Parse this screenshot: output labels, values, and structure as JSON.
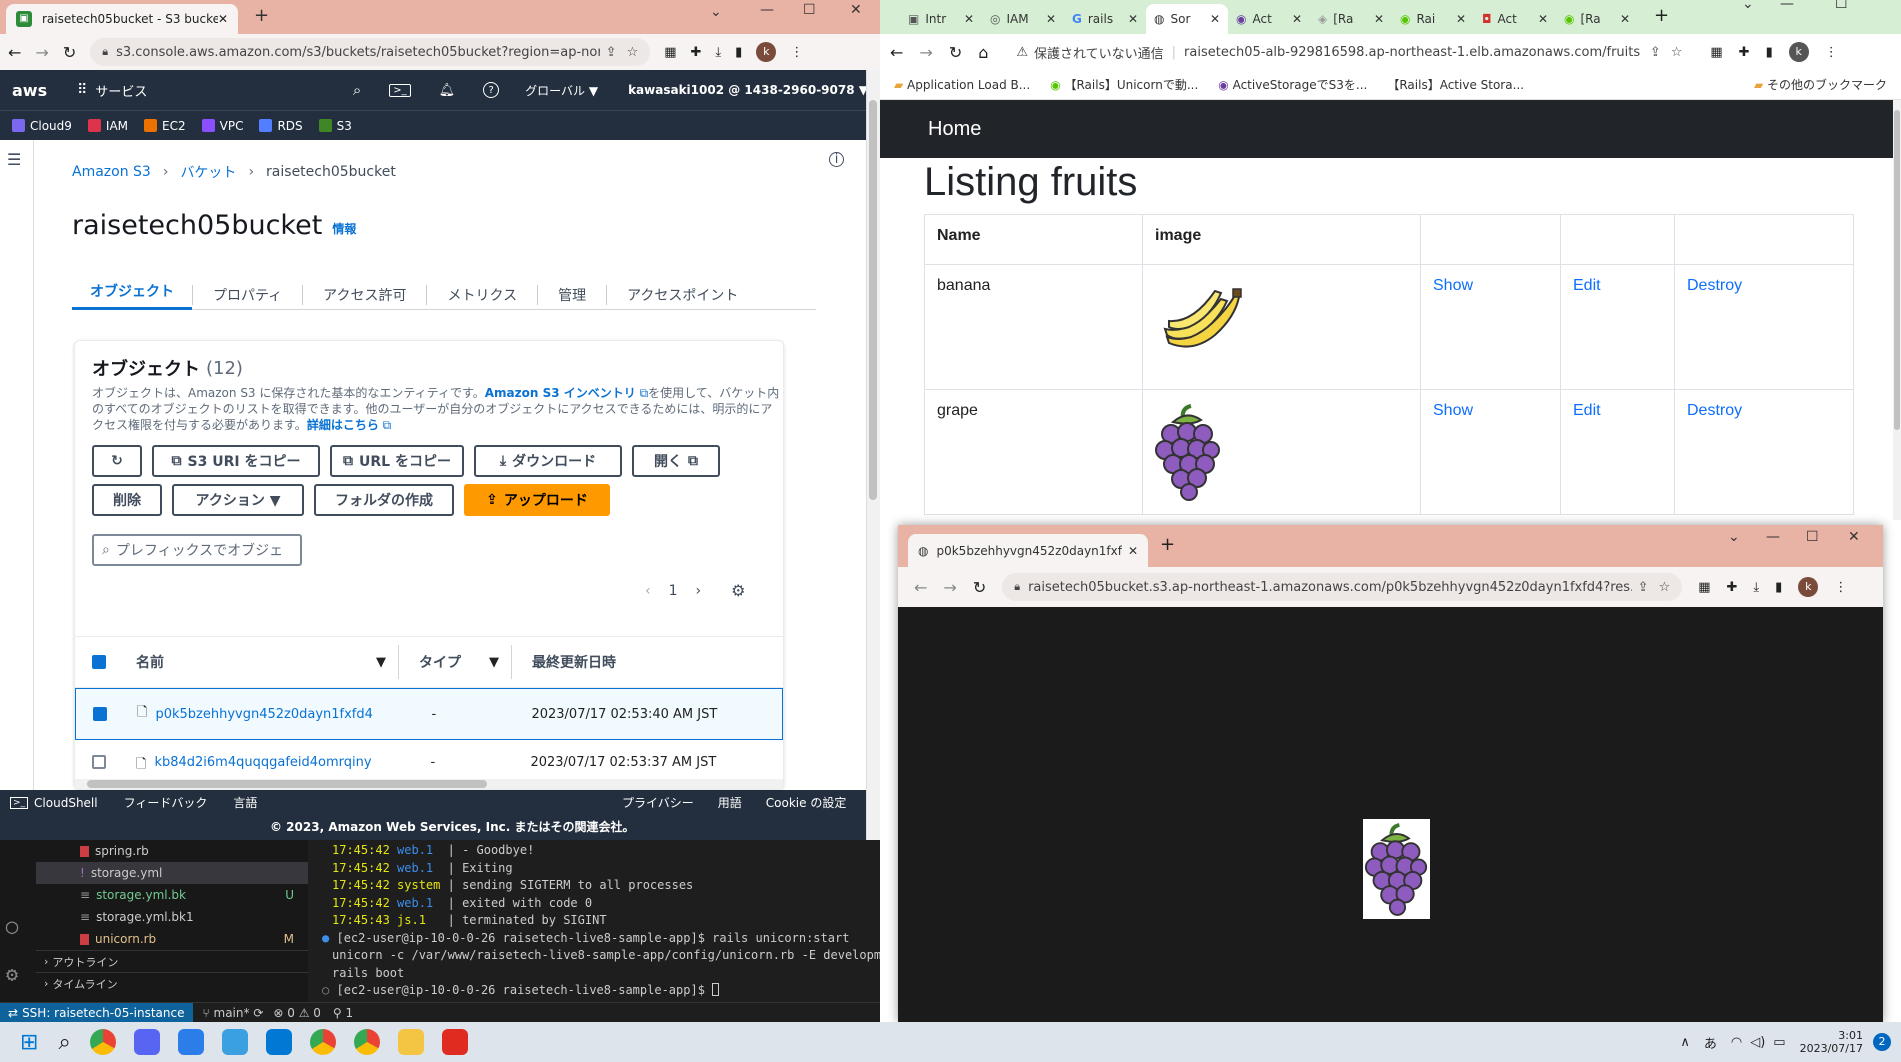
{
  "left_browser": {
    "tab_title": "raisetech05bucket - S3 bucket",
    "url": "s3.console.aws.amazon.com/s3/buckets/raisetech05bucket?region=ap-nor...",
    "avatar": "k"
  },
  "aws_nav": {
    "logo": "aws",
    "services": "サービス",
    "region": "グローバル ▼",
    "account": "kawasaki1002 @ 1438-2960-9078 ▼",
    "favorites": [
      "Cloud9",
      "IAM",
      "EC2",
      "VPC",
      "RDS",
      "S3"
    ],
    "favorite_colors": [
      "#7b68ee",
      "#dd344c",
      "#ed7100",
      "#8c4fff",
      "#527fff",
      "#3f8624"
    ]
  },
  "s3": {
    "breadcrumb": [
      "Amazon S3",
      "バケット",
      "raisetech05bucket"
    ],
    "bucket_name": "raisetech05bucket",
    "info_label": "情報",
    "tabs": [
      "オブジェクト",
      "プロパティ",
      "アクセス許可",
      "メトリクス",
      "管理",
      "アクセスポイント"
    ],
    "objects_heading": "オブジェクト",
    "objects_count": "(12)",
    "description_1": "オブジェクトは、Amazon S3 に保存された基本的なエンティティです。",
    "inventory_link": "Amazon S3 インベントリ",
    "description_2": "を使用して、バケット内のすべてのオブジェクトのリストを取得できます。他のユーザーが自分のオブジェクトにアクセスできるためには、明示的にアクセス権限を付与する必要があります。",
    "more_link": "詳細はこちら",
    "buttons_row1": [
      "S3 URI をコピー",
      "URL をコピー",
      "ダウンロード",
      "開く"
    ],
    "buttons_row2": [
      "削除",
      "アクション ▼",
      "フォルダの作成",
      "アップロード"
    ],
    "search_placeholder": "プレフィックスでオブジェ",
    "page": "1",
    "columns": [
      "名前",
      "タイプ",
      "最終更新日時"
    ],
    "rows": [
      {
        "name": "p0k5bzehhyvgn452z0dayn1fxfd4",
        "type": "-",
        "modified": "2023/07/17 02:53:40 AM JST",
        "selected": true
      },
      {
        "name": "kb84d2i6m4quqqgafeid4omrqiny",
        "type": "-",
        "modified": "2023/07/17 02:53:37 AM JST",
        "selected": false
      }
    ]
  },
  "aws_footer": {
    "cloudshell": "CloudShell",
    "feedback": "フィードバック",
    "language": "言語",
    "privacy": "プライバシー",
    "terms": "用語",
    "cookie": "Cookie の設定",
    "copyright": "© 2023, Amazon Web Services, Inc. またはその関連会社。"
  },
  "vscode": {
    "files": [
      {
        "name": "spring.rb",
        "badge": "",
        "icon_color": "#cc3e44"
      },
      {
        "name": "storage.yml",
        "badge": "",
        "icon_color": "#a074c4"
      },
      {
        "name": "storage.yml.bk",
        "badge": "U",
        "icon_color": "#999999"
      },
      {
        "name": "storage.yml.bk1",
        "badge": "",
        "icon_color": "#999999"
      },
      {
        "name": "unicorn.rb",
        "badge": "M",
        "icon_color": "#cc3e44"
      }
    ],
    "outline": "アウトライン",
    "timeline": "タイムライン",
    "terminal": [
      {
        "time": "17:45:42",
        "src": "web.1",
        "msg": "- Goodbye!"
      },
      {
        "time": "17:45:42",
        "src": "web.1",
        "msg": "Exiting"
      },
      {
        "time": "17:45:42",
        "src": "system",
        "msg": "sending SIGTERM to all processes"
      },
      {
        "time": "17:45:42",
        "src": "web.1",
        "msg": "exited with code 0"
      },
      {
        "time": "17:45:43",
        "src": "js.1",
        "msg": "terminated by SIGINT"
      }
    ],
    "prompt1": "[ec2-user@ip-10-0-0-26 raisetech-live8-sample-app]$ rails unicorn:start",
    "cmd_out1": "unicorn -c /var/www/raisetech-live8-sample-app/config/unicorn.rb -E development -D",
    "cmd_out2": "rails boot",
    "prompt2": "[ec2-user@ip-10-0-0-26 raisetech-live8-sample-app]$ ",
    "status_remote": "SSH: raisetech-05-instance",
    "status_branch": "main*",
    "status_problems": "⊗ 0 ⚠ 0",
    "status_ports": "1"
  },
  "right_browser": {
    "tabs": [
      "Intr",
      "IAM",
      "rails",
      "Sor",
      "Act",
      "[Ra",
      "Rai",
      "Act",
      "[Ra"
    ],
    "active_tab_index": 3,
    "security_label": "保護されていない通信",
    "url": "raisetech05-alb-929816598.ap-northeast-1.elb.amazonaws.com/fruits",
    "bookmarks": [
      "Application Load B...",
      "【Rails】Unicornで動...",
      "ActiveStorageでS3を...",
      "【Rails】Active Stora..."
    ],
    "other_bookmarks": "その他のブックマーク",
    "avatar": "k"
  },
  "rails": {
    "nav_home": "Home",
    "heading": "Listing fruits",
    "columns": [
      "Name",
      "image",
      "",
      "",
      ""
    ],
    "fruits": [
      {
        "name": "banana",
        "show": "Show",
        "edit": "Edit",
        "destroy": "Destroy"
      },
      {
        "name": "grape",
        "show": "Show",
        "edit": "Edit",
        "destroy": "Destroy"
      }
    ]
  },
  "popup": {
    "tab_title": "p0k5bzehhyvgn452z0dayn1fxfd4",
    "url": "raisetech05bucket.s3.ap-northeast-1.amazonaws.com/p0k5bzehhyvgn452z0dayn1fxfd4?res...",
    "avatar": "k"
  },
  "taskbar": {
    "time": "3:01",
    "date": "2023/07/17",
    "ime": "あ",
    "notifications": "2"
  }
}
